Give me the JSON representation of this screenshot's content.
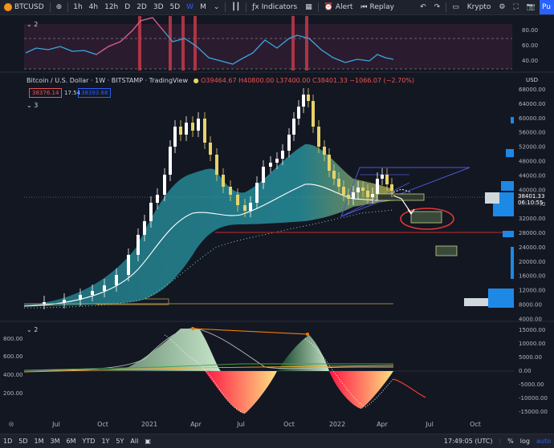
{
  "toolbar": {
    "symbol": "BTCUSD",
    "intervals": [
      "1h",
      "4h",
      "12h",
      "D",
      "2D",
      "3D",
      "5D",
      "W",
      "M"
    ],
    "active_interval": "W",
    "indicators_label": "Indicators",
    "alert_label": "Alert",
    "replay_label": "Replay",
    "layout_name": "Krypto",
    "publish_label": "Pu"
  },
  "legend": {
    "title": "Bitcoin / U.S. Dollar",
    "interval": "1W",
    "exchange": "BITSTAMP",
    "source": "TradingView",
    "o": "39464.67",
    "h": "40800.00",
    "l": "37400.00",
    "c": "38401.33",
    "change": "−1066.07 (−2.70%)",
    "sell": "38376.14",
    "spread": "17.54",
    "buy": "38393.68",
    "top_pane_tag": "2",
    "main_pane_tag": "3",
    "bottom_pane_tag": "2",
    "currency": "USD"
  },
  "price_label": {
    "price": "38401.33",
    "countdown": "06:10:55"
  },
  "bottom": {
    "ranges": [
      "1D",
      "5D",
      "1M",
      "3M",
      "6M",
      "YTD",
      "1Y",
      "5Y",
      "All"
    ],
    "time": "17:49:05 (UTC)",
    "scale_pct": "%",
    "scale_log": "log",
    "scale_auto": "auto"
  },
  "axes": {
    "x_labels": [
      "Jul",
      "Oct",
      "2021",
      "Apr",
      "Jul",
      "Oct",
      "2022",
      "Apr",
      "Jul",
      "Oct"
    ],
    "top_right": [
      "80.00",
      "60.00",
      "40.00"
    ],
    "main_right": [
      "68000.00",
      "64000.00",
      "60000.00",
      "56000.00",
      "52000.00",
      "48000.00",
      "44000.00",
      "40000.00",
      "36000.00",
      "32000.00",
      "28000.00",
      "24000.00",
      "20000.00",
      "16000.00",
      "12000.00",
      "8000.00",
      "4000.00"
    ],
    "osc_right": [
      "15000.00",
      "10000.00",
      "5000.00",
      "0.00",
      "-5000.00",
      "-10000.00",
      "-15000.00"
    ],
    "osc_left": [
      "800.00",
      "600.00",
      "400.00",
      "200.00"
    ]
  },
  "colors": {
    "bull": "#26a69a",
    "bear": "#ef5350",
    "candle_up": "#ffffff",
    "candle_down": "#e6d36b",
    "band": "#2bb3c0",
    "accent": "#2962ff",
    "rsi": "#3aa7e0"
  }
}
